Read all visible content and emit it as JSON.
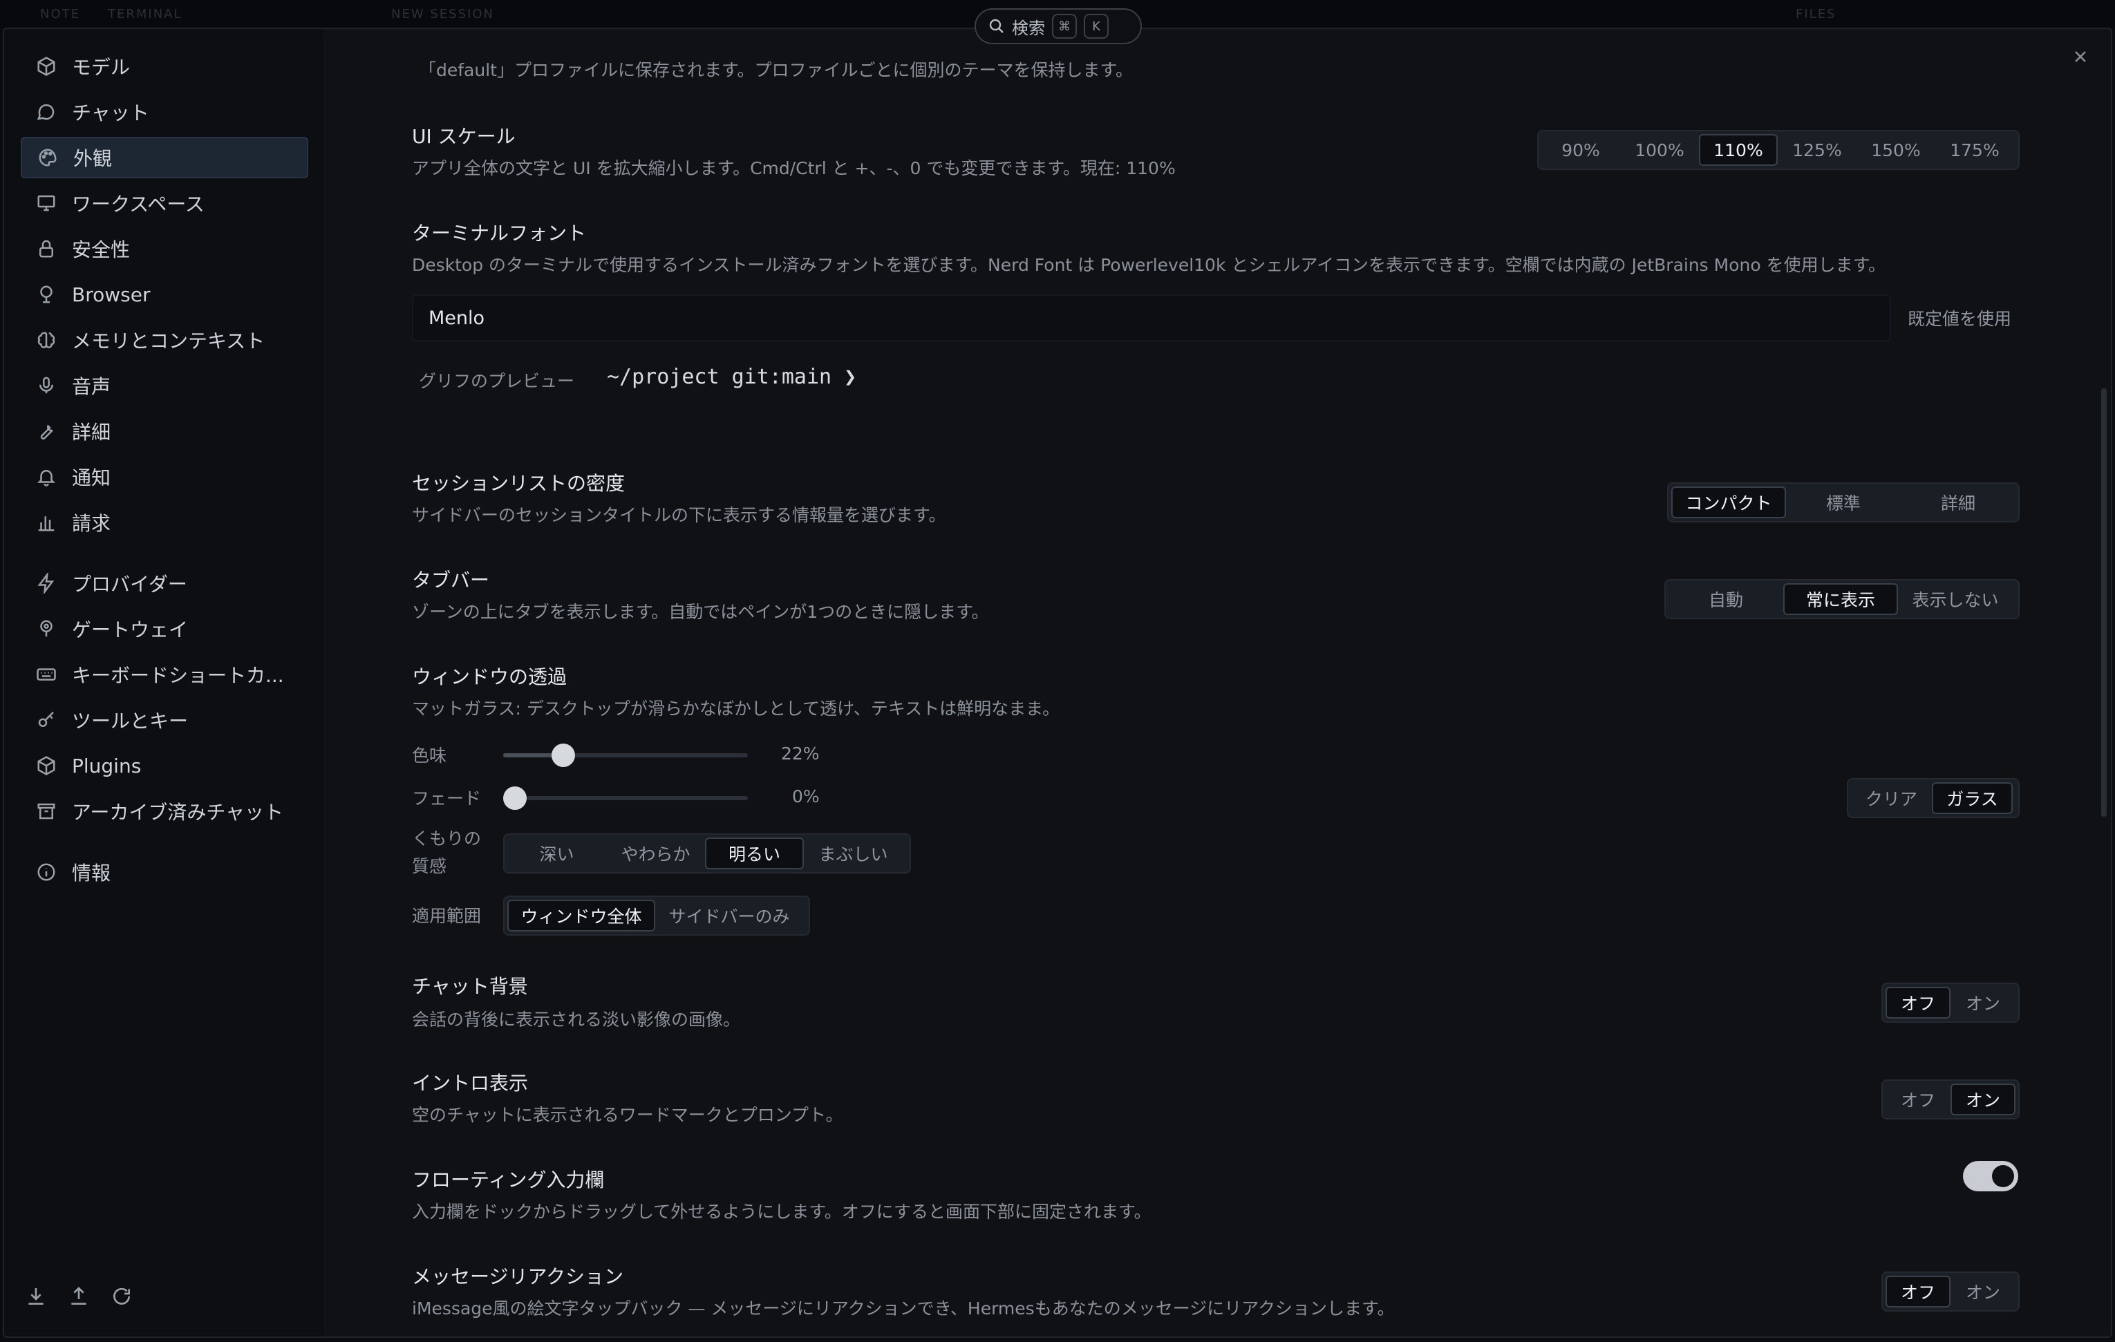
{
  "search": {
    "label": "検索",
    "key1": "⌘",
    "key2": "K"
  },
  "background_tabs": [
    "NOTE",
    "TERMINAL",
    "NEW SESSION",
    "FILES"
  ],
  "sidebar": {
    "items": [
      {
        "label": "モデル",
        "icon": "cube-icon"
      },
      {
        "label": "チャット",
        "icon": "chat-bubble-icon"
      },
      {
        "label": "外観",
        "icon": "palette-icon",
        "active": true
      },
      {
        "label": "ワークスペース",
        "icon": "monitor-icon"
      },
      {
        "label": "安全性",
        "icon": "lock-icon"
      },
      {
        "label": "Browser",
        "icon": "globe-pin-icon"
      },
      {
        "label": "メモリとコンテキスト",
        "icon": "brain-icon"
      },
      {
        "label": "音声",
        "icon": "microphone-icon"
      },
      {
        "label": "詳細",
        "icon": "wrench-icon"
      },
      {
        "label": "通知",
        "icon": "bell-icon"
      },
      {
        "label": "請求",
        "icon": "bar-chart-icon"
      },
      {
        "label": "プロバイダー",
        "icon": "lightning-icon"
      },
      {
        "label": "ゲートウェイ",
        "icon": "gateway-icon"
      },
      {
        "label": "キーボードショートカ...",
        "icon": "keyboard-icon"
      },
      {
        "label": "ツールとキー",
        "icon": "key-icon"
      },
      {
        "label": "Plugins",
        "icon": "package-icon"
      },
      {
        "label": "アーカイブ済みチャット",
        "icon": "archive-icon"
      },
      {
        "label": "情報",
        "icon": "info-icon"
      }
    ],
    "footer_icons": [
      "download-icon",
      "upload-icon",
      "refresh-icon"
    ]
  },
  "settings": {
    "theme_note": "「default」プロファイルに保存されます。プロファイルごとに個別のテーマを保持します。",
    "ui_scale": {
      "title": "UI スケール",
      "desc": "アプリ全体の文字と UI を拡大縮小します。Cmd/Ctrl と +、-、0 でも変更できます。現在: 110%",
      "options": [
        "90%",
        "100%",
        "110%",
        "125%",
        "150%",
        "175%"
      ],
      "selected": "110%"
    },
    "terminal_font": {
      "title": "ターミナルフォント",
      "desc": "Desktop のターミナルで使用するインストール済みフォントを選びます。Nerd Font は Powerlevel10k とシェルアイコンを表示できます。空欄では内蔵の JetBrains Mono を使用します。",
      "value": "Menlo",
      "default_button": "既定値を使用",
      "preview_label": "グリフのプレビュー",
      "preview_text": "~/project git:main ❯"
    },
    "session_density": {
      "title": "セッションリストの密度",
      "desc": "サイドバーのセッションタイトルの下に表示する情報量を選びます。",
      "options": [
        "コンパクト",
        "標準",
        "詳細"
      ],
      "selected": "コンパクト"
    },
    "tab_bar": {
      "title": "タブバー",
      "desc": "ゾーンの上にタブを表示します。自動ではペインが1つのときに隠します。",
      "options": [
        "自動",
        "常に表示",
        "表示しない"
      ],
      "selected": "常に表示"
    },
    "window_transparency": {
      "title": "ウィンドウの透過",
      "desc": "マットガラス: デスクトップが滑らかなぼかしとして透け、テキストは鮮明なまま。",
      "tint_label": "色味",
      "tint_value": "22%",
      "tint_level": 0.22,
      "fade_label": "フェード",
      "fade_value": "0%",
      "fade_level": 0,
      "frost_label": "くもりの質感",
      "frost_options": [
        "深い",
        "やわらか",
        "明るい",
        "まぶしい"
      ],
      "frost_selected": "明るい",
      "scope_label": "適用範囲",
      "scope_options": [
        "ウィンドウ全体",
        "サイドバーのみ"
      ],
      "scope_selected": "ウィンドウ全体",
      "mode_options": [
        "クリア",
        "ガラス"
      ],
      "mode_selected": "ガラス"
    },
    "chat_background": {
      "title": "チャット背景",
      "desc": "会話の背後に表示される淡い影像の画像。",
      "options": [
        "オフ",
        "オン"
      ],
      "selected": "オフ"
    },
    "intro": {
      "title": "イントロ表示",
      "desc": "空のチャットに表示されるワードマークとプロンプト。",
      "options": [
        "オフ",
        "オン"
      ],
      "selected": "オン"
    },
    "floating_input": {
      "title": "フローティング入力欄",
      "desc": "入力欄をドックからドラッグして外せるようにします。オフにすると画面下部に固定されます。",
      "enabled": true
    },
    "message_reactions": {
      "title": "メッセージリアクション",
      "desc": "iMessage風の絵文字タップバック — メッセージにリアクションでき、Hermesもあなたのメッセージにリアクションします。",
      "options": [
        "オフ",
        "オン"
      ],
      "selected": "オフ"
    }
  }
}
